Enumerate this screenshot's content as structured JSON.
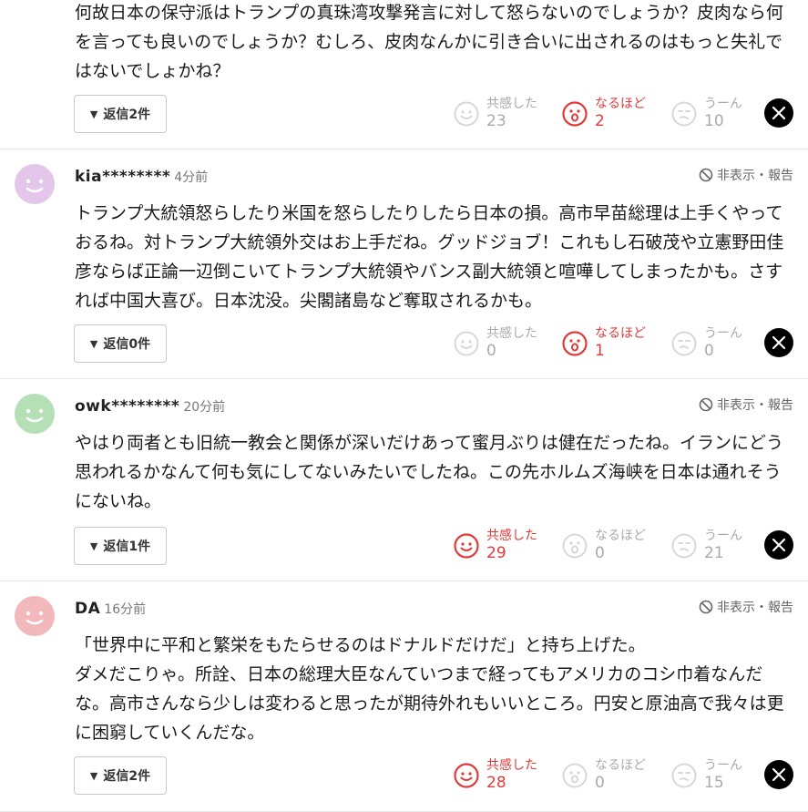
{
  "labels": {
    "reply_caret": "▼",
    "hide_report": "非表示・報告",
    "sympathy": "共感した",
    "naruhodo": "なるほど",
    "uun": "うーん",
    "x_logo": "X"
  },
  "colors": {
    "active": "#e03b3b",
    "inactive": "#c8c8c8",
    "avatar_purple": "#e3c6ea",
    "avatar_green": "#b5e0b6",
    "avatar_pink": "#f2b8bc"
  },
  "comments": [
    {
      "user": "",
      "time": "",
      "body": [
        "何故日本の保守派はトランプの真珠湾攻撃発言に対して怒らないのでしょうか？皮肉なら何を言っても良いのでしょうか？むしろ、皮肉なんかに引き合いに出されるのはもっと失礼ではないでしょかね？"
      ],
      "reply": "返信2件",
      "sympathy": "23",
      "naruhodo": "2",
      "uun": "10",
      "active": "naruhodo"
    },
    {
      "user": "kia********",
      "time": "4分前",
      "avatar": "purple",
      "body": [
        "トランプ大統領怒らしたり米国を怒らしたりしたら日本の損。高市早苗総理は上手くやっておるね。対トランプ大統領外交はお上手だね。グッドジョブ！これもし石破茂や立憲野田佳彦ならば正論一辺倒こいてトランプ大統領やバンス副大統領と喧嘩してしまったかも。さすれば中国大喜び。日本沈没。尖閣諸島など奪取されるかも。"
      ],
      "reply": "返信0件",
      "sympathy": "0",
      "naruhodo": "1",
      "uun": "0",
      "active": "naruhodo"
    },
    {
      "user": "owk********",
      "time": "20分前",
      "avatar": "green",
      "body": [
        "やはり両者とも旧統一教会と関係が深いだけあって蜜月ぶりは健在だったね。イランにどう思われるかなんて何も気にしてないみたいでしたね。この先ホルムズ海峡を日本は通れそうにないね。"
      ],
      "reply": "返信1件",
      "sympathy": "29",
      "naruhodo": "0",
      "uun": "21",
      "active": "sympathy"
    },
    {
      "user": "DA",
      "time": "16分前",
      "avatar": "pink",
      "body": [
        "「世界中に平和と繁栄をもたらせるのはドナルドだけだ」と持ち上げた。",
        "ダメだこりゃ。所詮、日本の総理大臣なんていつまで経ってもアメリカのコシ巾着なんだな。高市さんなら少しは変わると思ったが期待外れもいいところ。円安と原油高で我々は更に困窮していくんだな。"
      ],
      "reply": "返信2件",
      "sympathy": "28",
      "naruhodo": "0",
      "uun": "15",
      "active": "sympathy"
    }
  ]
}
